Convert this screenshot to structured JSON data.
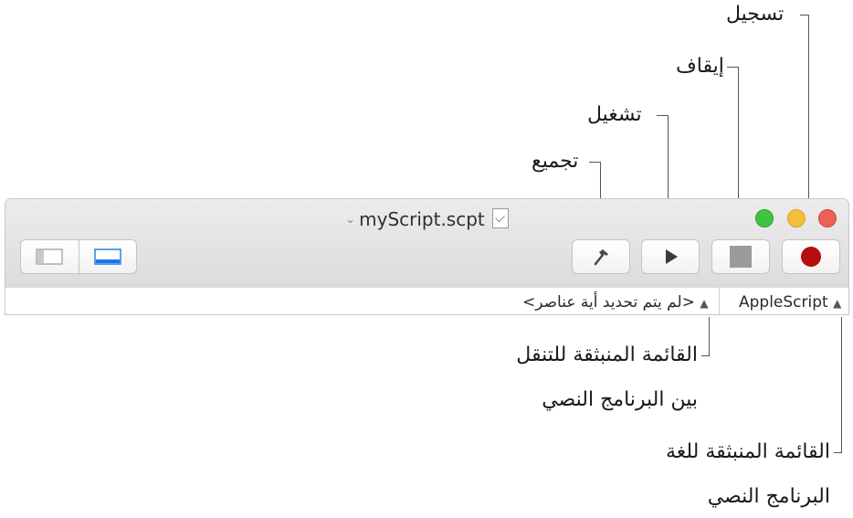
{
  "callouts": {
    "record": "تسجيل",
    "stop": "إيقاف",
    "run": "تشغيل",
    "compile": "تجميع",
    "navigation_line1": "القائمة المنبثقة للتنقل",
    "navigation_line2": "بين البرنامج النصي",
    "language_line1": "القائمة المنبثقة للغة",
    "language_line2": "البرنامج النصي"
  },
  "window": {
    "title": "myScript.scpt",
    "title_chevron_icon": "chevron-down-icon",
    "document_icon": "script-document-icon"
  },
  "toolbar": {
    "record_icon": "record-icon",
    "stop_icon": "stop-icon",
    "run_icon": "play-icon",
    "compile_icon": "hammer-icon",
    "view_left_icon": "sidebar-icon",
    "view_right_icon": "bottom-panel-icon"
  },
  "navbar": {
    "language_value": "AppleScript",
    "navigation_value": "<لم يتم تحديد أية عناصر>"
  },
  "colors": {
    "close": "#ee5f57",
    "minimize": "#f6bd3b",
    "zoom": "#3fc43f",
    "record": "#b70d0d",
    "accent": "#1e74e8"
  }
}
